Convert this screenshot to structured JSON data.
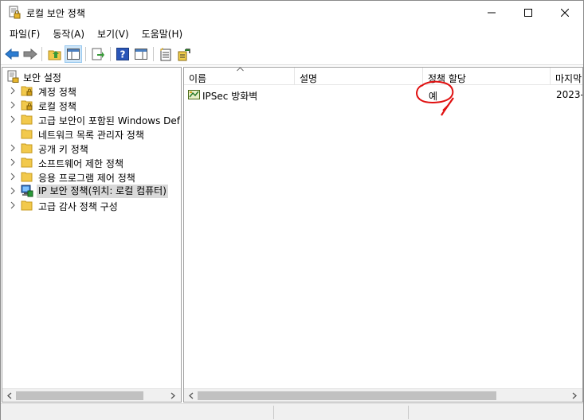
{
  "window": {
    "title": "로컬 보안 정책",
    "icon": "local-security-policy-icon"
  },
  "menubar": {
    "items": [
      "파일(F)",
      "동작(A)",
      "보기(V)",
      "도움말(H)"
    ]
  },
  "toolbar": {
    "buttons": [
      "back-arrow-icon",
      "forward-arrow-icon",
      "up-folder-icon",
      "show-hide-tree-icon",
      "export-list-icon",
      "help-icon",
      "console-tree-icon",
      "properties-icon",
      "assign-policy-icon"
    ]
  },
  "tree": {
    "root": "보안 설정",
    "items": [
      {
        "label": "계정 정책",
        "icon": "folder-lock-icon"
      },
      {
        "label": "로컬 정책",
        "icon": "folder-lock-icon"
      },
      {
        "label": "고급 보안이 포함된 Windows Def",
        "icon": "folder-icon"
      },
      {
        "label": "네트워크 목록 관리자 정책",
        "icon": "folder-icon"
      },
      {
        "label": "공개 키 정책",
        "icon": "folder-icon"
      },
      {
        "label": "소프트웨어 제한 정책",
        "icon": "folder-icon"
      },
      {
        "label": "응용 프로그램 제어 정책",
        "icon": "folder-icon"
      },
      {
        "label": "IP 보안 정책(위치: 로컬 컴퓨터)",
        "icon": "ip-security-icon",
        "selected": true
      },
      {
        "label": "고급 감사 정책 구성",
        "icon": "folder-icon"
      }
    ]
  },
  "list": {
    "columns": [
      "이름",
      "설명",
      "정책 할당",
      "마지막"
    ],
    "rows": [
      {
        "name": "IPSec 방화벽",
        "description": "",
        "assigned": "예",
        "modified": "2023-"
      }
    ]
  },
  "annotation": {
    "type": "red-circle-mark",
    "color": "#e01010"
  },
  "colors": {
    "selection": "#d9d9d9",
    "toolbar_active": "#cce4f7",
    "folder": "#f2c94c",
    "annotation": "#e01010"
  }
}
